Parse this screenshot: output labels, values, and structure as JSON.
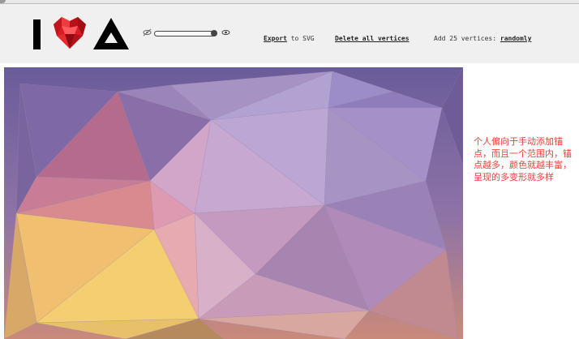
{
  "toolbar": {
    "export_link": "Export",
    "export_suffix": " to SVG",
    "delete_link": "Delete all vertices",
    "random_prefix": "Add 25 vertices: ",
    "random_link": "randomly",
    "icons": [
      "letter-i-logo",
      "heart-gem-logo",
      "triangle-logo",
      "eye-off-icon",
      "eye-icon"
    ]
  },
  "opacity_slider": {
    "value": 1.0
  },
  "annotation": {
    "text": "个人偏向于手动添加锚点，而且一个范围内，锚点越多，颜色就越丰富，呈现的多变形就多样",
    "color": "#e8423a"
  }
}
